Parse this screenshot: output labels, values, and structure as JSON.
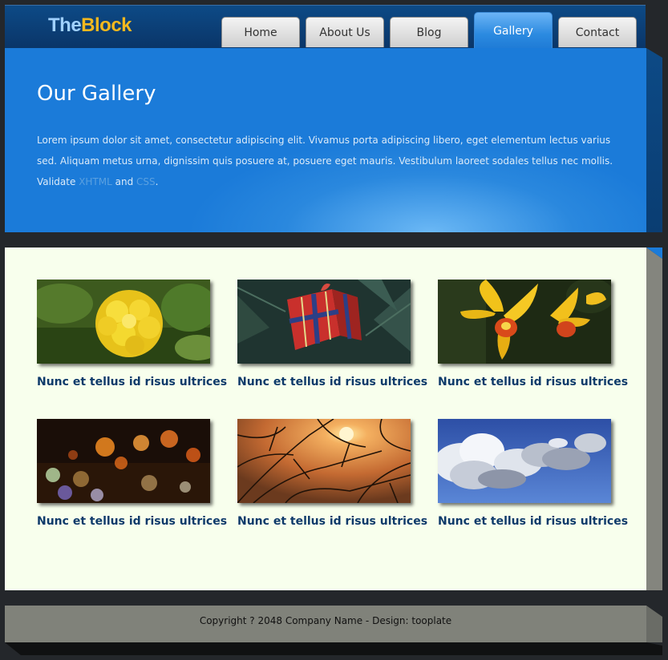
{
  "logo": {
    "part1": "The",
    "part2": "Block"
  },
  "nav": {
    "items": [
      {
        "label": "Home"
      },
      {
        "label": "About Us"
      },
      {
        "label": "Blog"
      },
      {
        "label": "Gallery",
        "active": true
      },
      {
        "label": "Contact"
      }
    ]
  },
  "intro": {
    "title": "Our Gallery",
    "text": "Lorem ipsum dolor sit amet, consectetur adipiscing elit. Vivamus porta adipiscing libero, eget elementum lectus varius sed. Aliquam metus urna, dignissim quis posuere at, posuere eget mauris. Vestibulum laoreet sodales tellus nec mollis.",
    "validate_prefix": "Validate",
    "validate_xhtml": "XHTML",
    "validate_and": "and",
    "validate_css": "CSS",
    "validate_suffix": "."
  },
  "gallery": {
    "items": [
      {
        "caption": "Nunc et tellus id risus ultrices",
        "image": "yellow-flower"
      },
      {
        "caption": "Nunc et tellus id risus ultrices",
        "image": "gift-box"
      },
      {
        "caption": "Nunc et tellus id risus ultrices",
        "image": "orchid"
      },
      {
        "caption": "Nunc et tellus id risus ultrices",
        "image": "bokeh-lights"
      },
      {
        "caption": "Nunc et tellus id risus ultrices",
        "image": "sunset-branches"
      },
      {
        "caption": "Nunc et tellus id risus ultrices",
        "image": "clouds-sky"
      }
    ]
  },
  "footer": {
    "copyright": "Copyright ? 2048 Company Name - Design: tooplate"
  },
  "colors": {
    "accent": "#1b7bd9",
    "header": "#0a3568",
    "gallery_bg": "#f8ffed",
    "caption": "#0e3a6a",
    "logo_the": "#9fd0ff",
    "logo_block": "#f4b81e"
  }
}
